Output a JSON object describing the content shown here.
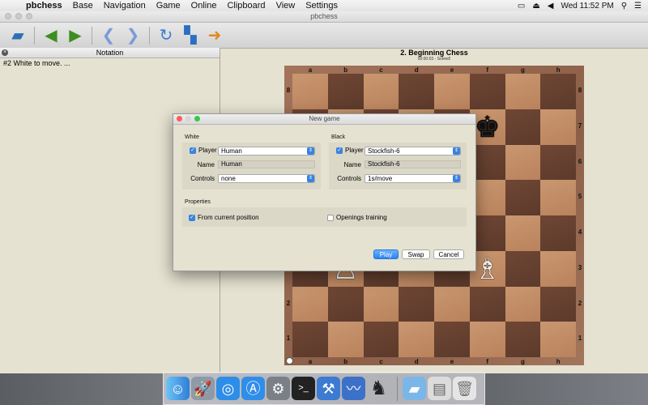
{
  "menubar": {
    "app_name": "pbchess",
    "menus": [
      "Base",
      "Navigation",
      "Game",
      "Online",
      "Clipboard",
      "View",
      "Settings"
    ],
    "clock": "Wed 11:52 PM"
  },
  "window": {
    "title": "pbchess"
  },
  "toolbar": {
    "icons": [
      "folder-icon",
      "back-green-icon",
      "forward-green-icon",
      "back-blue-icon",
      "forward-blue-icon",
      "refresh-icon",
      "analysis-icon",
      "play-arrow-icon"
    ]
  },
  "notation": {
    "header": "Notation",
    "text": "#2 White to move. ..."
  },
  "game": {
    "title": "2. Beginning Chess",
    "subtitle": "00:00:03 - Solved!"
  },
  "board": {
    "files": [
      "a",
      "b",
      "c",
      "d",
      "e",
      "f",
      "g",
      "h"
    ],
    "ranks": [
      "8",
      "7",
      "6",
      "5",
      "4",
      "3",
      "2",
      "1"
    ],
    "pieces": {
      "f7": "♚",
      "b3": "♙",
      "f3": "♗"
    }
  },
  "dialog": {
    "title": "New game",
    "white": {
      "group": "White",
      "player_label": "Player",
      "player": "Human",
      "name_label": "Name",
      "name": "Human",
      "controls_label": "Controls",
      "controls": "none"
    },
    "black": {
      "group": "Black",
      "player_label": "Player",
      "player": "Stockfish-6",
      "name_label": "Name",
      "name": "Stockfish-6",
      "controls_label": "Controls",
      "controls": "1s/move"
    },
    "properties": {
      "group": "Properties",
      "from_current": "From current position",
      "openings": "Openings training"
    },
    "buttons": {
      "play": "Play",
      "swap": "Swap",
      "cancel": "Cancel"
    }
  }
}
